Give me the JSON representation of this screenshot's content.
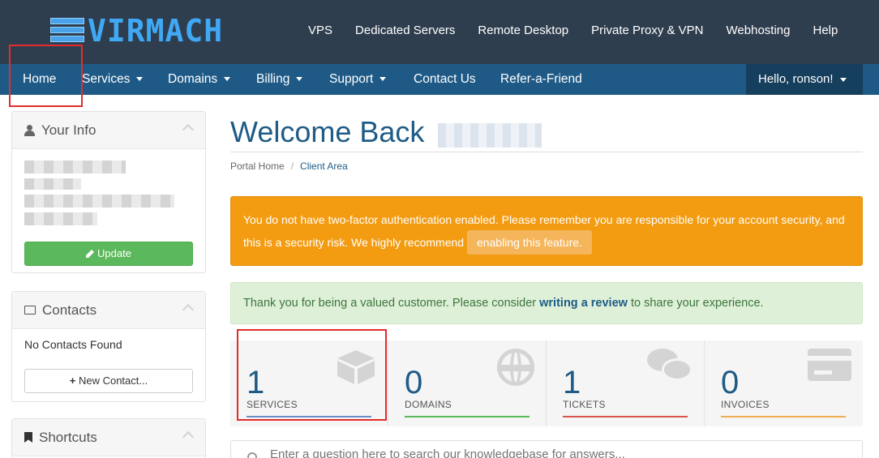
{
  "brand": {
    "name": "VIRMACH"
  },
  "top_nav": [
    "VPS",
    "Dedicated Servers",
    "Remote Desktop",
    "Private Proxy & VPN",
    "Webhosting",
    "Help"
  ],
  "main_nav": {
    "home": "Home",
    "services": "Services",
    "domains": "Domains",
    "billing": "Billing",
    "support": "Support",
    "contact": "Contact Us",
    "refer": "Refer-a-Friend",
    "user_menu": "Hello, ronson!"
  },
  "sidebar": {
    "your_info": {
      "title": "Your Info",
      "update_label": "Update"
    },
    "contacts": {
      "title": "Contacts",
      "empty": "No Contacts Found",
      "new_label": "New Contact..."
    },
    "shortcuts": {
      "title": "Shortcuts"
    }
  },
  "page": {
    "title": "Welcome Back",
    "breadcrumb": [
      "Portal Home",
      "Client Area"
    ]
  },
  "alerts": {
    "twofa_text": "You do not have two-factor authentication enabled. Please remember you are responsible for your account security, and this is a security risk. We highly recommend",
    "twofa_button": "enabling this feature.",
    "review_prefix": "Thank you for being a valued customer. Please consider",
    "review_link": "writing a review",
    "review_suffix": "to share your experience."
  },
  "tiles": [
    {
      "count": "1",
      "label": "SERVICES",
      "color": "#6b8fc9"
    },
    {
      "count": "0",
      "label": "DOMAINS",
      "color": "#5cb85c"
    },
    {
      "count": "1",
      "label": "TICKETS",
      "color": "#d9534f"
    },
    {
      "count": "0",
      "label": "INVOICES",
      "color": "#f0ad4e"
    }
  ],
  "kb_search": {
    "placeholder": "Enter a question here to search our knowledgebase for answers..."
  },
  "colors": {
    "header": "#2f3e4e",
    "nav": "#1f5a87",
    "accent": "#1e5b86",
    "warning": "#f39c12",
    "success_bg": "#dff0d8"
  }
}
